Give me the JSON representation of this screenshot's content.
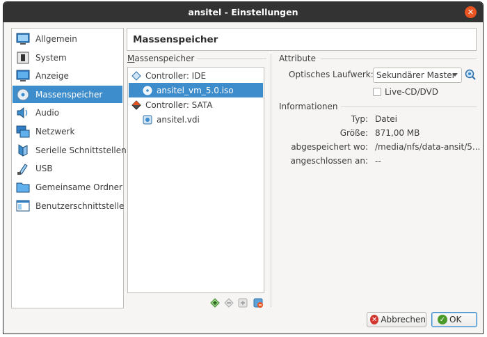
{
  "window": {
    "title": "ansitel - Einstellungen"
  },
  "sidebar": {
    "items": [
      {
        "label": "Allgemein",
        "icon": "general-icon"
      },
      {
        "label": "System",
        "icon": "system-icon"
      },
      {
        "label": "Anzeige",
        "icon": "display-icon"
      },
      {
        "label": "Massenspeicher",
        "icon": "storage-icon",
        "active": true
      },
      {
        "label": "Audio",
        "icon": "audio-icon"
      },
      {
        "label": "Netzwerk",
        "icon": "network-icon"
      },
      {
        "label": "Serielle Schnittstellen",
        "icon": "serial-port-icon"
      },
      {
        "label": "USB",
        "icon": "usb-icon"
      },
      {
        "label": "Gemeinsame Ordner",
        "icon": "shared-folder-icon"
      },
      {
        "label": "Benutzerschnittstelle",
        "icon": "user-interface-icon"
      }
    ]
  },
  "page": {
    "title": "Massenspeicher"
  },
  "storage": {
    "group_label": "Massenspeicher",
    "tree": [
      {
        "label": "Controller: IDE",
        "level": 0,
        "icon": "ide-controller-icon"
      },
      {
        "label": "ansitel_vm_5.0.iso",
        "level": 1,
        "icon": "optical-disc-icon",
        "selected": true
      },
      {
        "label": "Controller: SATA",
        "level": 0,
        "icon": "sata-controller-icon"
      },
      {
        "label": "ansitel.vdi",
        "level": 1,
        "icon": "hard-disk-icon"
      }
    ]
  },
  "attributes": {
    "group_label": "Attribute",
    "optical_drive_label": "Optisches Laufwerk:",
    "optical_drive_value": "Sekundärer Master",
    "live_cd_label": "Live-CD/DVD",
    "live_cd_checked": false
  },
  "information": {
    "group_label": "Informationen",
    "rows": [
      {
        "key": "Typ:",
        "value": "Datei"
      },
      {
        "key": "Größe:",
        "value": "871,00 MB"
      },
      {
        "key": "abgespeichert wo:",
        "value": "/media/nfs/data-ansit/5..."
      },
      {
        "key": "angeschlossen an:",
        "value": "--"
      }
    ]
  },
  "buttons": {
    "cancel": "Abbrechen",
    "ok": "OK"
  },
  "colors": {
    "selection": "#3d8dcd",
    "titlebar": "#333333",
    "close": "#e95420"
  }
}
